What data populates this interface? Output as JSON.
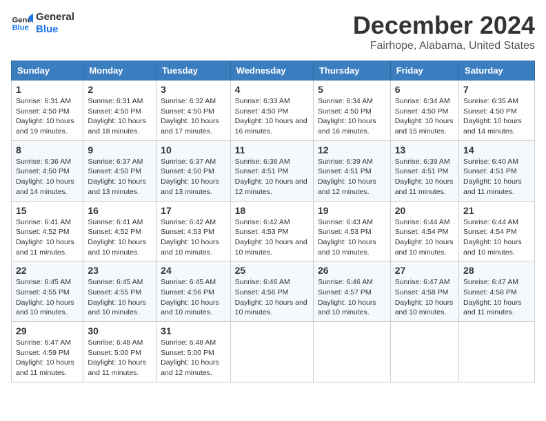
{
  "logo": {
    "text_general": "General",
    "text_blue": "Blue"
  },
  "title": "December 2024",
  "subtitle": "Fairhope, Alabama, United States",
  "headers": [
    "Sunday",
    "Monday",
    "Tuesday",
    "Wednesday",
    "Thursday",
    "Friday",
    "Saturday"
  ],
  "weeks": [
    [
      {
        "day": "1",
        "sunrise": "Sunrise: 6:31 AM",
        "sunset": "Sunset: 4:50 PM",
        "daylight": "Daylight: 10 hours and 19 minutes."
      },
      {
        "day": "2",
        "sunrise": "Sunrise: 6:31 AM",
        "sunset": "Sunset: 4:50 PM",
        "daylight": "Daylight: 10 hours and 18 minutes."
      },
      {
        "day": "3",
        "sunrise": "Sunrise: 6:32 AM",
        "sunset": "Sunset: 4:50 PM",
        "daylight": "Daylight: 10 hours and 17 minutes."
      },
      {
        "day": "4",
        "sunrise": "Sunrise: 6:33 AM",
        "sunset": "Sunset: 4:50 PM",
        "daylight": "Daylight: 10 hours and 16 minutes."
      },
      {
        "day": "5",
        "sunrise": "Sunrise: 6:34 AM",
        "sunset": "Sunset: 4:50 PM",
        "daylight": "Daylight: 10 hours and 16 minutes."
      },
      {
        "day": "6",
        "sunrise": "Sunrise: 6:34 AM",
        "sunset": "Sunset: 4:50 PM",
        "daylight": "Daylight: 10 hours and 15 minutes."
      },
      {
        "day": "7",
        "sunrise": "Sunrise: 6:35 AM",
        "sunset": "Sunset: 4:50 PM",
        "daylight": "Daylight: 10 hours and 14 minutes."
      }
    ],
    [
      {
        "day": "8",
        "sunrise": "Sunrise: 6:36 AM",
        "sunset": "Sunset: 4:50 PM",
        "daylight": "Daylight: 10 hours and 14 minutes."
      },
      {
        "day": "9",
        "sunrise": "Sunrise: 6:37 AM",
        "sunset": "Sunset: 4:50 PM",
        "daylight": "Daylight: 10 hours and 13 minutes."
      },
      {
        "day": "10",
        "sunrise": "Sunrise: 6:37 AM",
        "sunset": "Sunset: 4:50 PM",
        "daylight": "Daylight: 10 hours and 13 minutes."
      },
      {
        "day": "11",
        "sunrise": "Sunrise: 6:38 AM",
        "sunset": "Sunset: 4:51 PM",
        "daylight": "Daylight: 10 hours and 12 minutes."
      },
      {
        "day": "12",
        "sunrise": "Sunrise: 6:39 AM",
        "sunset": "Sunset: 4:51 PM",
        "daylight": "Daylight: 10 hours and 12 minutes."
      },
      {
        "day": "13",
        "sunrise": "Sunrise: 6:39 AM",
        "sunset": "Sunset: 4:51 PM",
        "daylight": "Daylight: 10 hours and 11 minutes."
      },
      {
        "day": "14",
        "sunrise": "Sunrise: 6:40 AM",
        "sunset": "Sunset: 4:51 PM",
        "daylight": "Daylight: 10 hours and 11 minutes."
      }
    ],
    [
      {
        "day": "15",
        "sunrise": "Sunrise: 6:41 AM",
        "sunset": "Sunset: 4:52 PM",
        "daylight": "Daylight: 10 hours and 11 minutes."
      },
      {
        "day": "16",
        "sunrise": "Sunrise: 6:41 AM",
        "sunset": "Sunset: 4:52 PM",
        "daylight": "Daylight: 10 hours and 10 minutes."
      },
      {
        "day": "17",
        "sunrise": "Sunrise: 6:42 AM",
        "sunset": "Sunset: 4:53 PM",
        "daylight": "Daylight: 10 hours and 10 minutes."
      },
      {
        "day": "18",
        "sunrise": "Sunrise: 6:42 AM",
        "sunset": "Sunset: 4:53 PM",
        "daylight": "Daylight: 10 hours and 10 minutes."
      },
      {
        "day": "19",
        "sunrise": "Sunrise: 6:43 AM",
        "sunset": "Sunset: 4:53 PM",
        "daylight": "Daylight: 10 hours and 10 minutes."
      },
      {
        "day": "20",
        "sunrise": "Sunrise: 6:44 AM",
        "sunset": "Sunset: 4:54 PM",
        "daylight": "Daylight: 10 hours and 10 minutes."
      },
      {
        "day": "21",
        "sunrise": "Sunrise: 6:44 AM",
        "sunset": "Sunset: 4:54 PM",
        "daylight": "Daylight: 10 hours and 10 minutes."
      }
    ],
    [
      {
        "day": "22",
        "sunrise": "Sunrise: 6:45 AM",
        "sunset": "Sunset: 4:55 PM",
        "daylight": "Daylight: 10 hours and 10 minutes."
      },
      {
        "day": "23",
        "sunrise": "Sunrise: 6:45 AM",
        "sunset": "Sunset: 4:55 PM",
        "daylight": "Daylight: 10 hours and 10 minutes."
      },
      {
        "day": "24",
        "sunrise": "Sunrise: 6:45 AM",
        "sunset": "Sunset: 4:56 PM",
        "daylight": "Daylight: 10 hours and 10 minutes."
      },
      {
        "day": "25",
        "sunrise": "Sunrise: 6:46 AM",
        "sunset": "Sunset: 4:56 PM",
        "daylight": "Daylight: 10 hours and 10 minutes."
      },
      {
        "day": "26",
        "sunrise": "Sunrise: 6:46 AM",
        "sunset": "Sunset: 4:57 PM",
        "daylight": "Daylight: 10 hours and 10 minutes."
      },
      {
        "day": "27",
        "sunrise": "Sunrise: 6:47 AM",
        "sunset": "Sunset: 4:58 PM",
        "daylight": "Daylight: 10 hours and 10 minutes."
      },
      {
        "day": "28",
        "sunrise": "Sunrise: 6:47 AM",
        "sunset": "Sunset: 4:58 PM",
        "daylight": "Daylight: 10 hours and 11 minutes."
      }
    ],
    [
      {
        "day": "29",
        "sunrise": "Sunrise: 6:47 AM",
        "sunset": "Sunset: 4:59 PM",
        "daylight": "Daylight: 10 hours and 11 minutes."
      },
      {
        "day": "30",
        "sunrise": "Sunrise: 6:48 AM",
        "sunset": "Sunset: 5:00 PM",
        "daylight": "Daylight: 10 hours and 11 minutes."
      },
      {
        "day": "31",
        "sunrise": "Sunrise: 6:48 AM",
        "sunset": "Sunset: 5:00 PM",
        "daylight": "Daylight: 10 hours and 12 minutes."
      },
      null,
      null,
      null,
      null
    ]
  ]
}
